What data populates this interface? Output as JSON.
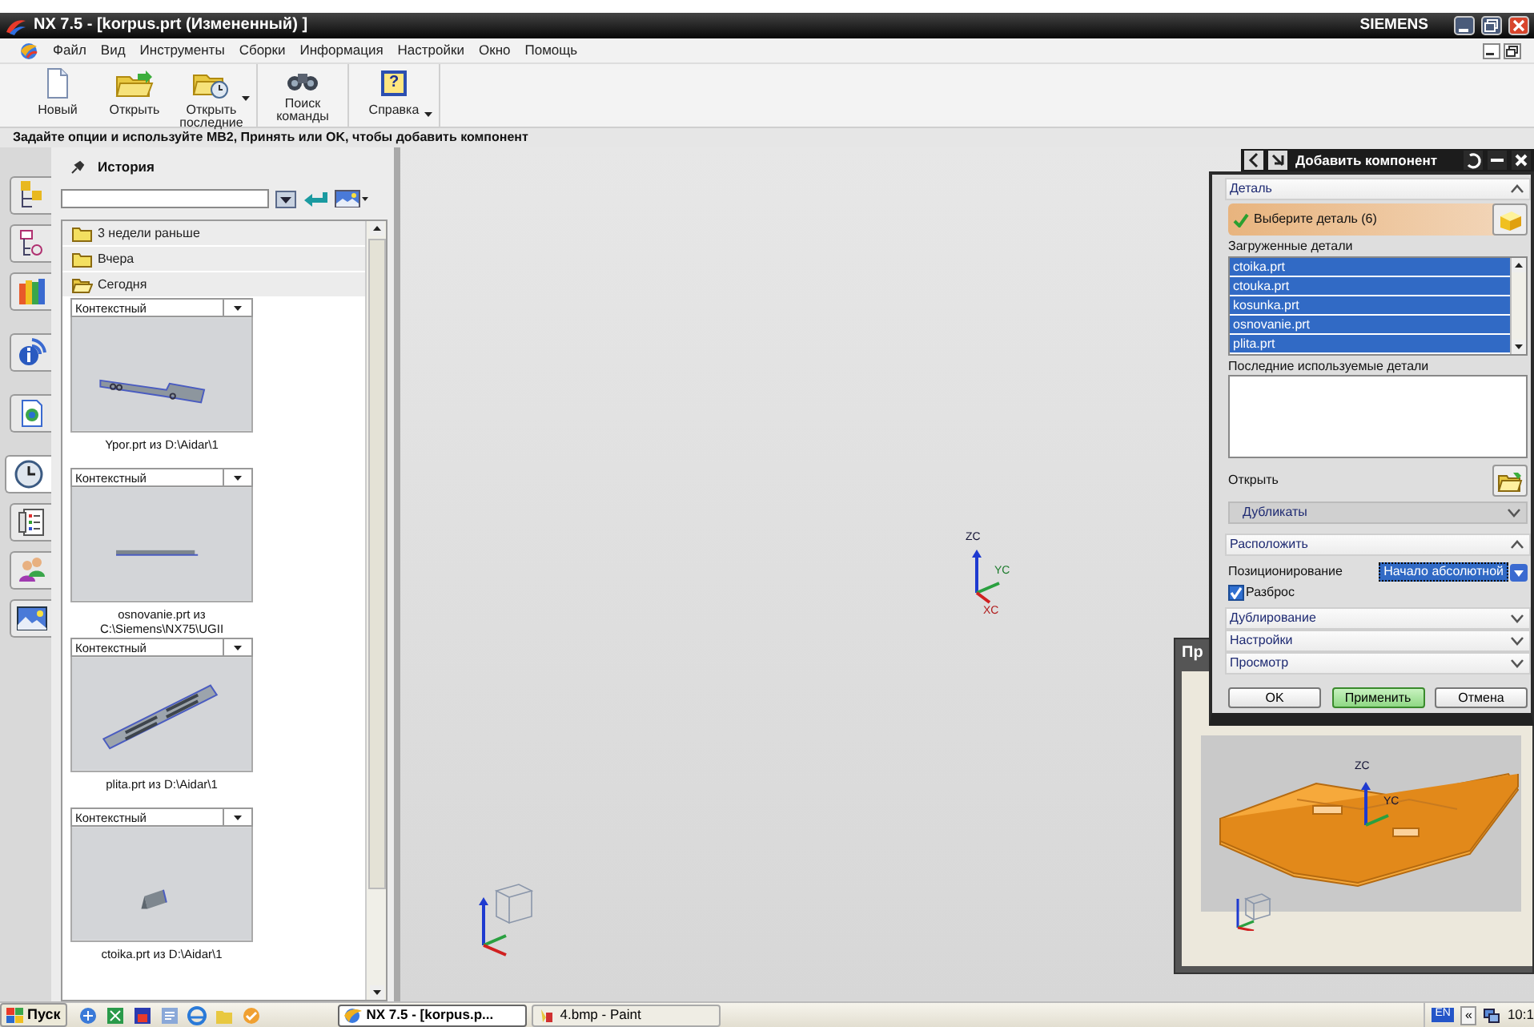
{
  "window": {
    "title": "NX 7.5 - [korpus.prt (Измененный) ]",
    "brand": "SIEMENS"
  },
  "menu": [
    "Файл",
    "Вид",
    "Инструменты",
    "Сборки",
    "Информация",
    "Настройки",
    "Окно",
    "Помощь"
  ],
  "toolbar": [
    {
      "label": "Новый",
      "kind": "new",
      "dropdown": false
    },
    {
      "label": "Открыть",
      "kind": "open",
      "dropdown": false
    },
    {
      "label": "Открыть последние",
      "kind": "recent",
      "dropdown": true
    },
    {
      "label": "Поиск команды",
      "kind": "find",
      "dropdown": false
    },
    {
      "label": "Справка",
      "kind": "help",
      "glyph": "?",
      "dropdown": true
    }
  ],
  "prompt": "Задайте опции и используйте MB2, Принять или OK, чтобы добавить компонент",
  "resource_bar": [
    {
      "kind": "assembly",
      "selected": false
    },
    {
      "kind": "constraints",
      "selected": false
    },
    {
      "kind": "library",
      "selected": false
    },
    {
      "kind": "info",
      "selected": false
    },
    {
      "kind": "document",
      "selected": false
    },
    {
      "kind": "history",
      "selected": true
    },
    {
      "kind": "process",
      "selected": false
    },
    {
      "kind": "roles",
      "selected": false
    },
    {
      "kind": "visual",
      "selected": false
    }
  ],
  "history": {
    "title": "История",
    "groups": [
      {
        "label": "3 недели раньше",
        "expanded": false
      },
      {
        "label": "Вчера",
        "expanded": false
      },
      {
        "label": "Сегодня",
        "expanded": true
      }
    ],
    "entries": [
      {
        "filter": "Контекстный",
        "kind": "plate",
        "caption": "Ypor.prt из D:\\Aidar\\1"
      },
      {
        "filter": "Контекстный",
        "kind": "rod",
        "caption": "osnovanie.prt из C:\\Siemens\\NX75\\UGII"
      },
      {
        "filter": "Контекстный",
        "kind": "slotted",
        "caption": "plita.prt из D:\\Aidar\\1"
      },
      {
        "filter": "Контекстный",
        "kind": "block",
        "caption": "ctoika.prt из D:\\Aidar\\1"
      }
    ]
  },
  "viewport": {
    "triad": [
      "ZC",
      "YC",
      "XC"
    ]
  },
  "dialog": {
    "title": "Добавить компонент",
    "part_section": {
      "title": "Деталь",
      "expanded": true,
      "step": "Выберите деталь (6)",
      "step_done": true,
      "loaded_label": "Загруженные детали",
      "loaded": [
        {
          "name": "ctoika.prt",
          "selected": true
        },
        {
          "name": "ctouka.prt",
          "selected": true
        },
        {
          "name": "kosunka.prt",
          "selected": true
        },
        {
          "name": "osnovanie.prt",
          "selected": true
        },
        {
          "name": "plita.prt",
          "selected": true
        }
      ],
      "recent_label": "Последние используемые детали",
      "open_label": "Открыть",
      "duplicates": {
        "title": "Дубликаты",
        "expanded": false
      }
    },
    "place_section": {
      "title": "Расположить",
      "expanded": true,
      "positioning_label": "Позиционирование",
      "positioning": "Начало абсолютной",
      "scatter": {
        "label": "Разброс",
        "checked": true
      }
    },
    "sections": [
      {
        "title": "Дублирование",
        "expanded": false
      },
      {
        "title": "Настройки",
        "expanded": false
      },
      {
        "title": "Просмотр",
        "expanded": false
      }
    ],
    "buttons": [
      {
        "label": "OK",
        "default": false
      },
      {
        "label": "Применить",
        "default": true
      },
      {
        "label": "Отмена",
        "default": false
      }
    ]
  },
  "preview": {
    "title": "Пр",
    "triad": [
      "ZC",
      "YC"
    ]
  },
  "taskbar": {
    "start": "Пуск",
    "tasks": [
      {
        "label": "NX 7.5 - [korpus.p...",
        "kind": "nx",
        "selected": true
      },
      {
        "label": "4.bmp - Paint",
        "kind": "paint",
        "selected": false
      }
    ],
    "language": "EN",
    "tray_toggle": "«",
    "clock": "10:1"
  }
}
